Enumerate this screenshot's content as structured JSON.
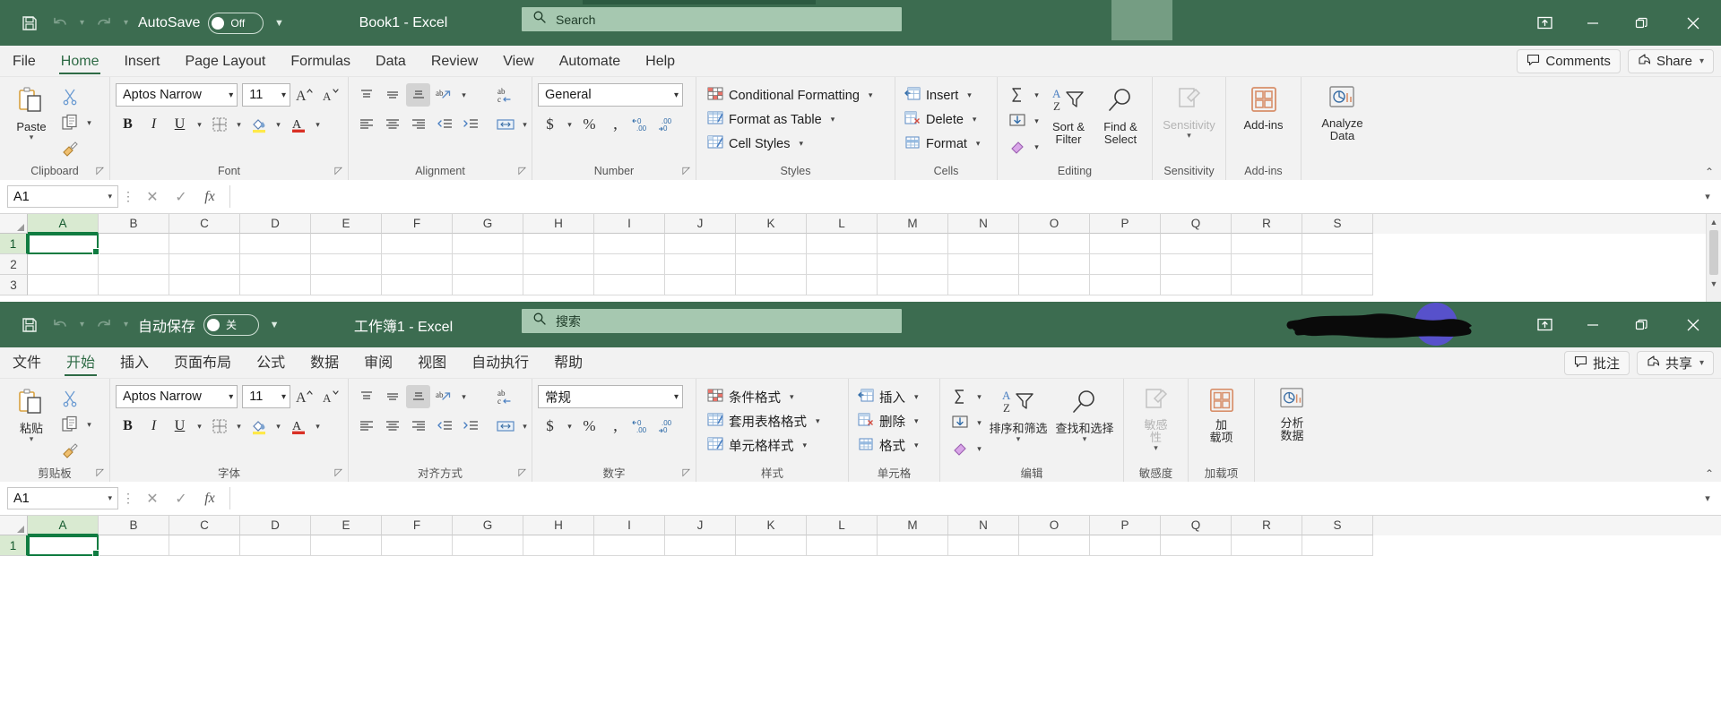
{
  "english_window": {
    "lang": "en",
    "titlebar": {
      "save_icon": "save-icon",
      "undo_icon": "undo-icon",
      "redo_icon": "redo-icon",
      "autosave_label": "AutoSave",
      "autosave_state": "Off",
      "qat_more_icon": "customize-quick-access-toolbar-icon",
      "document_title": "Book1  -  Excel",
      "search_placeholder": "Search",
      "search_icon": "search-icon",
      "ribbon_display_icon": "ribbon-display-options-icon",
      "minimize_icon": "minimize-icon",
      "restore_icon": "restore-icon",
      "close_icon": "close-icon"
    },
    "tabs": [
      {
        "label": "File",
        "active": false
      },
      {
        "label": "Home",
        "active": true
      },
      {
        "label": "Insert",
        "active": false
      },
      {
        "label": "Page Layout",
        "active": false
      },
      {
        "label": "Formulas",
        "active": false
      },
      {
        "label": "Data",
        "active": false
      },
      {
        "label": "Review",
        "active": false
      },
      {
        "label": "View",
        "active": false
      },
      {
        "label": "Automate",
        "active": false
      },
      {
        "label": "Help",
        "active": false
      }
    ],
    "tabstrip_right": {
      "comments_label": "Comments",
      "comments_icon": "comment-icon",
      "share_label": "Share",
      "share_icon": "share-icon",
      "share_caret": "chevron-down-icon"
    },
    "ribbon": {
      "clipboard": {
        "label": "Clipboard",
        "paste_label": "Paste",
        "cut_icon": "scissors-icon",
        "copy_icon": "copy-icon",
        "format_painter_icon": "format-painter-icon",
        "dialog_launcher": "dialog-box-launcher"
      },
      "font": {
        "label": "Font",
        "font_name": "Aptos Narrow",
        "font_size": "11",
        "grow_font_icon": "increase-font-size-icon",
        "shrink_font_icon": "decrease-font-size-icon",
        "bold": "B",
        "italic": "I",
        "underline": "U",
        "borders_icon": "borders-icon",
        "fill_color_icon": "fill-color-icon",
        "font_color_icon": "font-color-icon",
        "dialog_launcher": "dialog-box-launcher"
      },
      "alignment": {
        "label": "Alignment",
        "top_align_icon": "top-align-icon",
        "middle_align_icon": "middle-align-icon",
        "bottom_align_icon": "bottom-align-icon",
        "orientation_icon": "orientation-icon",
        "align_left_icon": "align-left-icon",
        "align_center_icon": "align-center-icon",
        "align_right_icon": "align-right-icon",
        "decrease_indent_icon": "decrease-indent-icon",
        "increase_indent_icon": "increase-indent-icon",
        "wrap_text_icon": "wrap-text-icon",
        "merge_center_icon": "merge-and-center-icon",
        "dialog_launcher": "dialog-box-launcher"
      },
      "number": {
        "label": "Number",
        "format_value": "General",
        "currency_icon": "accounting-number-format-icon",
        "percent_icon": "percent-style-icon",
        "comma_icon": "comma-style-icon",
        "increase_decimal_icon": "increase-decimal-icon",
        "decrease_decimal_icon": "decrease-decimal-icon",
        "dialog_launcher": "dialog-box-launcher"
      },
      "styles": {
        "label": "Styles",
        "items": [
          {
            "label": "Conditional Formatting",
            "icon": "conditional-formatting-icon",
            "caret": true
          },
          {
            "label": "Format as Table",
            "icon": "format-as-table-icon",
            "caret": true
          },
          {
            "label": "Cell Styles",
            "icon": "cell-styles-icon",
            "caret": true
          }
        ]
      },
      "cells": {
        "label": "Cells",
        "items": [
          {
            "label": "Insert",
            "icon": "insert-cells-icon",
            "caret": true
          },
          {
            "label": "Delete",
            "icon": "delete-cells-icon",
            "caret": true
          },
          {
            "label": "Format",
            "icon": "format-cells-icon",
            "caret": true
          }
        ]
      },
      "editing": {
        "label": "Editing",
        "autosum_icon": "autosum-icon",
        "fill_icon": "fill-icon",
        "clear_icon": "clear-icon",
        "sort_filter_label": "Sort &\nFilter",
        "sort_filter_line1": "Sort &",
        "sort_filter_line2": "Filter",
        "sort_filter_icon": "sort-and-filter-icon",
        "find_select_line1": "Find &",
        "find_select_line2": "Select",
        "find_select_icon": "find-and-select-icon"
      },
      "sensitivity": {
        "label": "Sensitivity",
        "button_label": "Sensitivity",
        "icon": "sensitivity-icon"
      },
      "addins": {
        "label": "Add-ins",
        "button_label": "Add-ins",
        "icon": "add-ins-icon"
      },
      "analyze": {
        "button_line1": "Analyze",
        "button_line2": "Data",
        "icon": "analyze-data-icon"
      },
      "collapse_icon": "collapse-ribbon-icon"
    },
    "formula_bar": {
      "name_box_value": "A1",
      "menu_icon": "more-options-icon",
      "cancel_icon": "cancel-icon",
      "enter_icon": "enter-icon",
      "fx_label": "fx",
      "formula_value": "",
      "expand_icon": "expand-formula-bar-icon"
    },
    "grid": {
      "columns": [
        "A",
        "B",
        "C",
        "D",
        "E",
        "F",
        "G",
        "H",
        "I",
        "J",
        "K",
        "L",
        "M",
        "N",
        "O",
        "P",
        "Q",
        "R",
        "S"
      ],
      "rows": [
        "1",
        "2",
        "3"
      ],
      "active_cell": "A1",
      "scroll_up_icon": "scroll-up-icon",
      "scroll_down_icon": "scroll-down-icon"
    }
  },
  "chinese_window": {
    "lang": "zh",
    "titlebar": {
      "save_icon": "save-icon",
      "undo_icon": "undo-icon",
      "redo_icon": "redo-icon",
      "autosave_label": "自动保存",
      "autosave_state": "关",
      "qat_more_icon": "customize-quick-access-toolbar-icon",
      "document_title": "工作簿1  -  Excel",
      "search_placeholder": "搜索",
      "search_icon": "search-icon",
      "account_redacted": "redacted-account-name",
      "avatar": "user-avatar",
      "ribbon_display_icon": "ribbon-display-options-icon",
      "minimize_icon": "minimize-icon",
      "restore_icon": "restore-icon",
      "close_icon": "close-icon"
    },
    "tabs": [
      {
        "label": "文件",
        "active": false
      },
      {
        "label": "开始",
        "active": true
      },
      {
        "label": "插入",
        "active": false
      },
      {
        "label": "页面布局",
        "active": false
      },
      {
        "label": "公式",
        "active": false
      },
      {
        "label": "数据",
        "active": false
      },
      {
        "label": "审阅",
        "active": false
      },
      {
        "label": "视图",
        "active": false
      },
      {
        "label": "自动执行",
        "active": false
      },
      {
        "label": "帮助",
        "active": false
      }
    ],
    "tabstrip_right": {
      "comments_label": "批注",
      "comments_icon": "comment-icon",
      "share_label": "共享",
      "share_icon": "share-icon",
      "share_caret": "chevron-down-icon"
    },
    "ribbon": {
      "clipboard": {
        "label": "剪贴板",
        "paste_label": "粘贴",
        "cut_icon": "scissors-icon",
        "copy_icon": "copy-icon",
        "format_painter_icon": "format-painter-icon",
        "dialog_launcher": "dialog-box-launcher"
      },
      "font": {
        "label": "字体",
        "font_name": "Aptos Narrow",
        "font_size": "11",
        "grow_font_icon": "increase-font-size-icon",
        "shrink_font_icon": "decrease-font-size-icon",
        "bold": "B",
        "italic": "I",
        "underline": "U",
        "borders_icon": "borders-icon",
        "fill_color_icon": "fill-color-icon",
        "font_color_icon": "font-color-icon",
        "dialog_launcher": "dialog-box-launcher"
      },
      "alignment": {
        "label": "对齐方式",
        "top_align_icon": "top-align-icon",
        "middle_align_icon": "middle-align-icon",
        "bottom_align_icon": "bottom-align-icon",
        "orientation_icon": "orientation-icon",
        "align_left_icon": "align-left-icon",
        "align_center_icon": "align-center-icon",
        "align_right_icon": "align-right-icon",
        "decrease_indent_icon": "decrease-indent-icon",
        "increase_indent_icon": "increase-indent-icon",
        "wrap_text_icon": "wrap-text-icon",
        "merge_center_icon": "merge-and-center-icon",
        "dialog_launcher": "dialog-box-launcher"
      },
      "number": {
        "label": "数字",
        "format_value": "常规",
        "currency_icon": "accounting-number-format-icon",
        "percent_icon": "percent-style-icon",
        "comma_icon": "comma-style-icon",
        "increase_decimal_icon": "increase-decimal-icon",
        "decrease_decimal_icon": "decrease-decimal-icon",
        "dialog_launcher": "dialog-box-launcher"
      },
      "styles": {
        "label": "样式",
        "items": [
          {
            "label": "条件格式",
            "icon": "conditional-formatting-icon",
            "caret": true
          },
          {
            "label": "套用表格格式",
            "icon": "format-as-table-icon",
            "caret": true
          },
          {
            "label": "单元格样式",
            "icon": "cell-styles-icon",
            "caret": true
          }
        ]
      },
      "cells": {
        "label": "单元格",
        "items": [
          {
            "label": "插入",
            "icon": "insert-cells-icon",
            "caret": true
          },
          {
            "label": "删除",
            "icon": "delete-cells-icon",
            "caret": true
          },
          {
            "label": "格式",
            "icon": "format-cells-icon",
            "caret": true
          }
        ]
      },
      "editing": {
        "label": "编辑",
        "autosum_icon": "autosum-icon",
        "fill_icon": "fill-icon",
        "clear_icon": "clear-icon",
        "sort_filter_line1": "排序和筛选",
        "sort_filter_line2": "",
        "sort_filter_icon": "sort-and-filter-icon",
        "find_select_line1": "查找和选择",
        "find_select_line2": "",
        "find_select_icon": "find-and-select-icon"
      },
      "sensitivity": {
        "label": "敏感度",
        "button_line1": "敏感",
        "button_line2": "性",
        "icon": "sensitivity-icon"
      },
      "addins": {
        "label": "加载项",
        "button_line1": "加",
        "button_line2": "载项",
        "icon": "add-ins-icon"
      },
      "analyze": {
        "button_line1": "分析",
        "button_line2": "数据",
        "icon": "analyze-data-icon"
      },
      "collapse_icon": "collapse-ribbon-icon"
    },
    "formula_bar": {
      "name_box_value": "A1",
      "menu_icon": "more-options-icon",
      "cancel_icon": "cancel-icon",
      "enter_icon": "enter-icon",
      "fx_label": "fx",
      "formula_value": "",
      "expand_icon": "expand-formula-bar-icon"
    },
    "grid": {
      "columns": [
        "A",
        "B",
        "C",
        "D",
        "E",
        "F",
        "G",
        "H",
        "I",
        "J",
        "K",
        "L",
        "M",
        "N",
        "O",
        "P",
        "Q",
        "R",
        "S"
      ],
      "rows": [
        "1"
      ],
      "active_cell": "A1"
    }
  },
  "colors": {
    "title_green": "#3c6c50",
    "search_green": "#a6c8b0",
    "ribbon_gray": "#f2f2f2",
    "accent_green": "#107c41",
    "tab_active": "#2f6b46"
  }
}
